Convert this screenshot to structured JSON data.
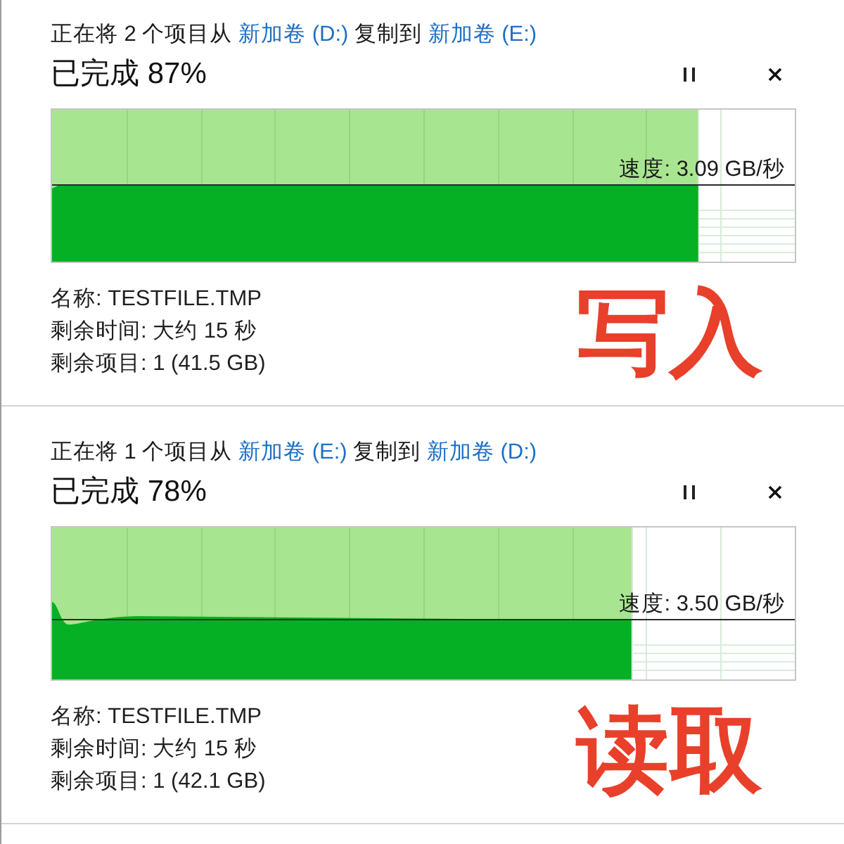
{
  "dialogs": [
    {
      "header": [
        {
          "kind": "text",
          "text": "正在将 2 个项目从 "
        },
        {
          "kind": "link",
          "text": "新加卷 (D:)"
        },
        {
          "kind": "text",
          "text": " 复制到 "
        },
        {
          "kind": "link",
          "text": "新加卷 (E:)"
        }
      ],
      "status": "已完成 87%",
      "progress": {
        "level": 0.87
      },
      "speed": "速度: 3.09 GB/秒",
      "details": {
        "name": "名称: TESTFILE.TMP",
        "time_remaining": "剩余时间: 大约 15 秒",
        "items_remaining": "剩余项目: 1 (41.5 GB)"
      },
      "annotation": "写入"
    },
    {
      "header": [
        {
          "kind": "text",
          "text": "正在将 1 个项目从 "
        },
        {
          "kind": "link",
          "text": "新加卷 (E:)"
        },
        {
          "kind": "text",
          "text": " 复制到 "
        },
        {
          "kind": "link",
          "text": "新加卷 (D:)"
        }
      ],
      "status": "已完成 78%",
      "progress": {
        "level": 0.78
      },
      "speed": "速度: 3.50 GB/秒",
      "details": {
        "name": "名称: TESTFILE.TMP",
        "time_remaining": "剩余时间: 大约 15 秒",
        "items_remaining": "剩余项目: 1 (42.1 GB)"
      },
      "annotation": "读取"
    }
  ]
}
